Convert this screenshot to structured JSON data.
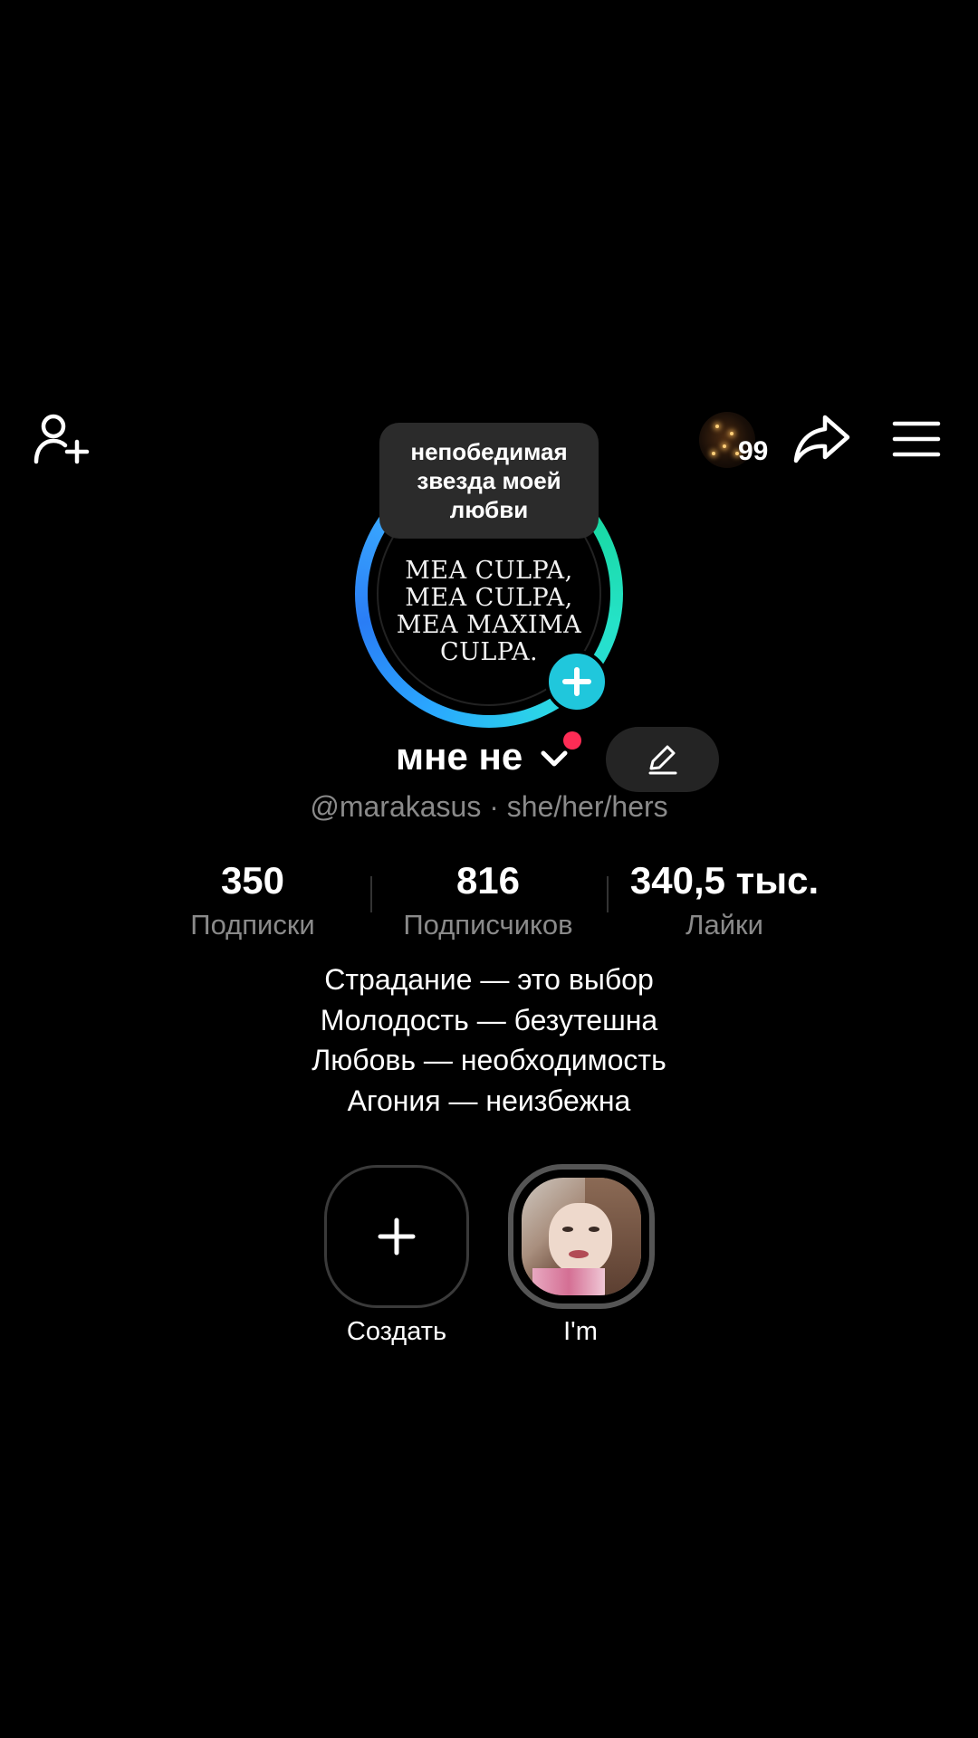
{
  "topbar": {
    "add_friend_icon": "person-plus-icon",
    "story_count": "99",
    "share_icon": "share-arrow-icon",
    "menu_icon": "hamburger-menu-icon"
  },
  "avatar": {
    "text_lines": [
      "MEA CULPA,",
      "MEA CULPA,",
      "MEA MAXIMA",
      "CULPA."
    ],
    "ring_colors": [
      "#20e3c2",
      "#2a7df5"
    ],
    "plus_color": "#20c7dc"
  },
  "tooltip": {
    "text": "непобедимая\nзвезда моей\nлюбви"
  },
  "profile": {
    "name": "мне не",
    "handle_line": "@marakasus · she/her/hers",
    "notification_dot_color": "#fe2c55"
  },
  "stats": [
    {
      "value": "350",
      "label": "Подписки"
    },
    {
      "value": "816",
      "label": "Подписчиков"
    },
    {
      "value": "340,5 тыс.",
      "label": "Лайки"
    }
  ],
  "bio": [
    "Страдание — это выбор",
    "Молодость — безутешна",
    "Любовь — необходимость",
    "Агония — неизбежна"
  ],
  "highlights": [
    {
      "label": "Создать"
    },
    {
      "label": "I'm"
    }
  ]
}
